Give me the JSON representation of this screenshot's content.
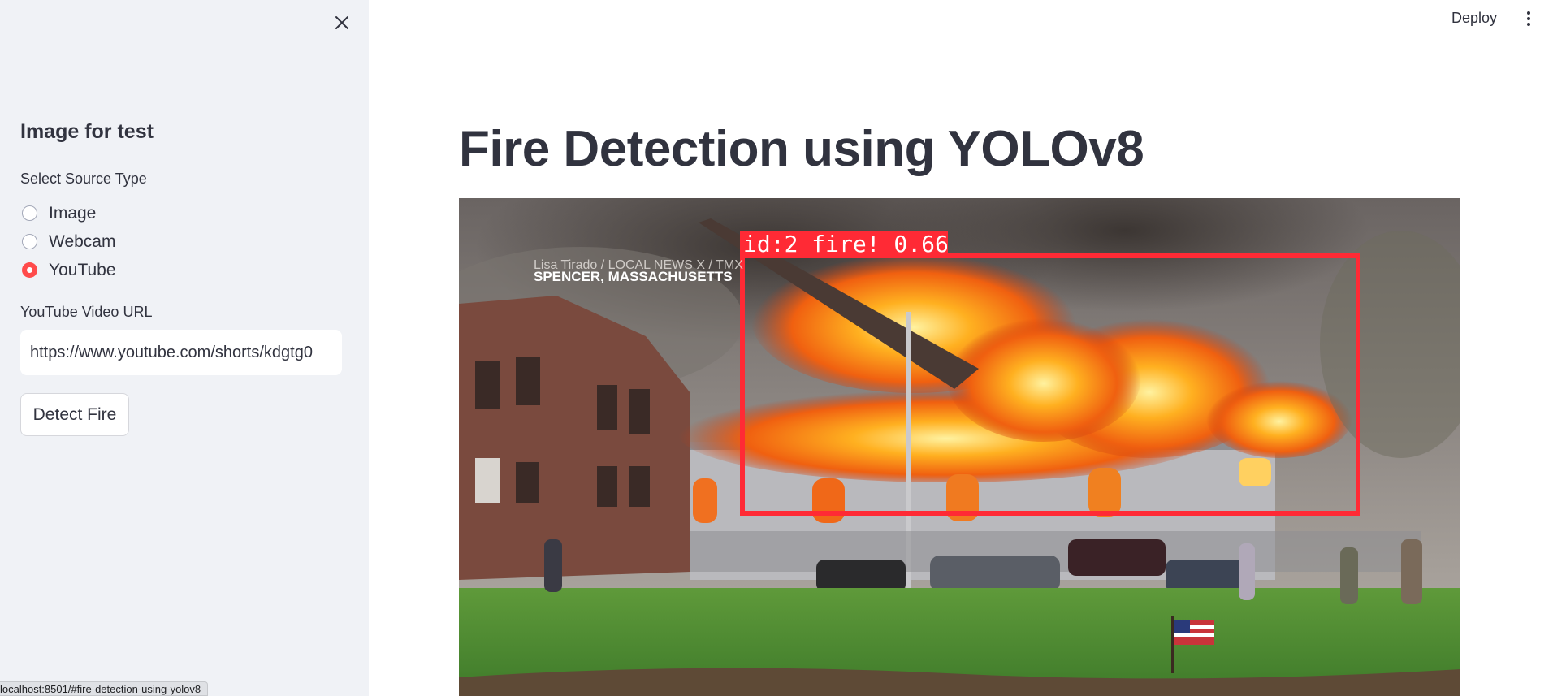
{
  "sidebar": {
    "title": "Image for test",
    "source_label": "Select Source Type",
    "source_options": [
      {
        "label": "Image",
        "selected": false
      },
      {
        "label": "Webcam",
        "selected": false
      },
      {
        "label": "YouTube",
        "selected": true
      }
    ],
    "url_label": "YouTube Video URL",
    "url_value": "https://www.youtube.com/shorts/kdgtg0",
    "detect_button": "Detect Fire",
    "close_icon": "close-icon"
  },
  "header": {
    "deploy_label": "Deploy",
    "menu_icon": "vertical-dots-icon"
  },
  "main": {
    "title": "Fire Detection using YOLOv8",
    "frame": {
      "caption_line1": "Lisa Tirado / LOCAL NEWS X / TMX",
      "caption_line2": "SPENCER, MASSACHUSETTS",
      "detection_label": "id:2 fire! 0.66"
    }
  },
  "status_bar": {
    "url": "localhost:8501/#fire-detection-using-yolov8"
  },
  "colors": {
    "accent": "#ff4b4b",
    "sidebar_bg": "#f0f2f6",
    "text": "#31333f",
    "detection_box": "#ff2a35"
  }
}
